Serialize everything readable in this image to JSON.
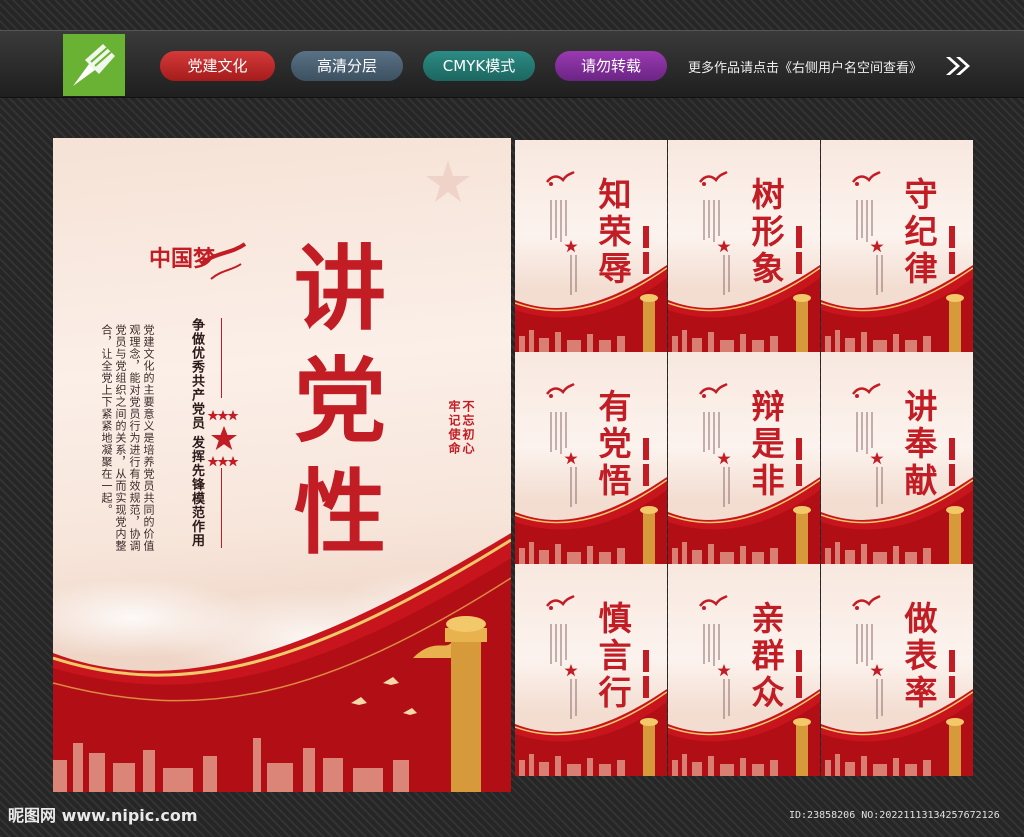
{
  "topbar": {
    "tags": [
      "党建文化",
      "高清分层",
      "CMYK模式",
      "请勿转载"
    ],
    "more_text": "更多作品请点击《右侧用户名空间查看》",
    "logo_icon": "pen-nib-icon",
    "arrow_icon": "double-chevron-right-icon"
  },
  "main_poster": {
    "title_chars": [
      "讲",
      "党",
      "性"
    ],
    "logo_text": "中国梦",
    "slogan": "争做优秀共产党员 发挥先锋模范作用",
    "body": "党建文化的主要意义是培养党员共同的价值观理念，能对党员行为进行有效规范，协调党员与党组织之间的关系，从而实现党内整合，让全党上下紧紧地凝聚在一起。",
    "seal_text": [
      "不忘初心",
      "牢记使命"
    ],
    "accent_color": "#c21c24"
  },
  "small_posters": [
    {
      "title": "知荣辱"
    },
    {
      "title": "树形象"
    },
    {
      "title": "守纪律"
    },
    {
      "title": "有党悟"
    },
    {
      "title": "辩是非"
    },
    {
      "title": "讲奉献"
    },
    {
      "title": "慎言行"
    },
    {
      "title": "亲群众"
    },
    {
      "title": "做表率"
    }
  ],
  "footer": {
    "site_logo": "昵图网 www.nipic.com",
    "id_text": "ID:23858206 NO:20221113134257672126"
  }
}
